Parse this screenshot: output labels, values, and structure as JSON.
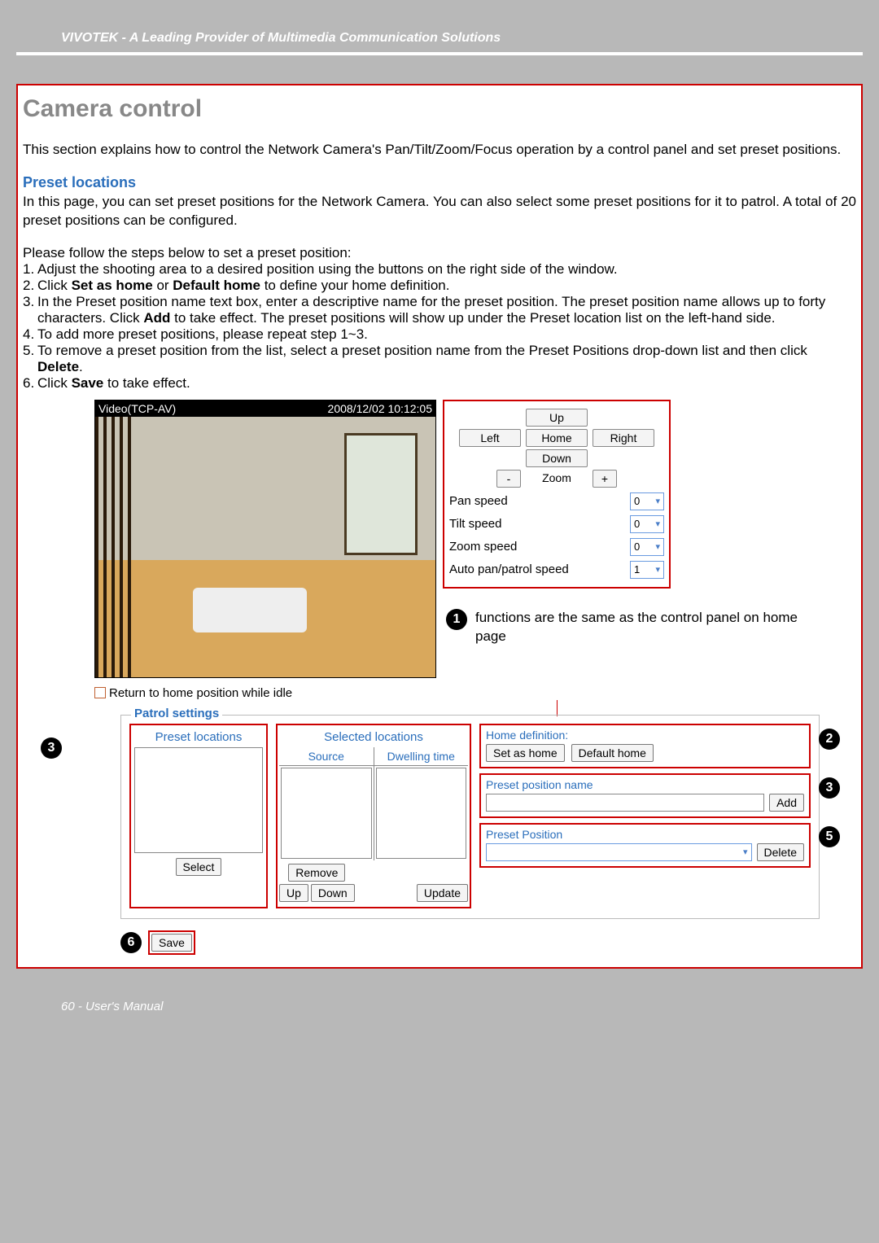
{
  "header": {
    "company_line": "VIVOTEK - A Leading Provider of Multimedia Communication Solutions"
  },
  "section": {
    "title": "Camera control",
    "intro": "This section explains how to control the Network Camera's Pan/Tilt/Zoom/Focus operation by a control panel and set preset positions.",
    "preset_heading": "Preset locations",
    "preset_desc": "In this page, you can set preset positions for the Network Camera. You can also select some preset positions for it to patrol. A total of 20 preset positions can be configured.",
    "steps_intro": "Please follow the steps below to set a preset position:",
    "steps": [
      "Adjust the shooting area to a desired position using the buttons on the right side of the window.",
      "Click Set as home or Default home to define your home definition.",
      "In the Preset position name text box, enter a descriptive name for the preset position. The preset position name allows up to forty characters. Click Add to take effect. The preset positions will show up under the Preset location list on the left-hand side.",
      "To add more preset positions, please repeat step 1~3.",
      "To remove a preset position from the list, select a preset position name from the Preset Positions drop-down list and then click Delete.",
      "Click Save to take effect."
    ],
    "step_bold": {
      "1": [
        "Set as home",
        "Default home"
      ],
      "2": [
        "Add"
      ],
      "4": [
        "Delete"
      ],
      "5": [
        "Save"
      ]
    }
  },
  "video": {
    "codec": "Video(TCP-AV)",
    "timestamp": "2008/12/02 10:12:05",
    "idle_label": "Return to home position while idle"
  },
  "ctrl": {
    "up": "Up",
    "down": "Down",
    "left": "Left",
    "right": "Right",
    "home": "Home",
    "zoom": "Zoom",
    "minus": "-",
    "plus": "+",
    "pan_speed": "Pan speed",
    "tilt_speed": "Tilt speed",
    "zoom_speed": "Zoom speed",
    "auto_speed": "Auto pan/patrol speed",
    "val_pan": "0",
    "val_tilt": "0",
    "val_zoom": "0",
    "val_auto": "1"
  },
  "annot": {
    "a1": "functions are the same as the control panel on  home page"
  },
  "patrol": {
    "legend": "Patrol settings",
    "preset_locations": "Preset locations",
    "selected_locations": "Selected locations",
    "source": "Source",
    "dwelling": "Dwelling time",
    "select": "Select",
    "remove": "Remove",
    "up": "Up",
    "down": "Down",
    "update": "Update"
  },
  "right": {
    "home_def": "Home definition:",
    "set_home": "Set as home",
    "default_home": "Default home",
    "ppn": "Preset position name",
    "add": "Add",
    "pp": "Preset Position",
    "delete": "Delete"
  },
  "save": {
    "label": "Save"
  },
  "badges": {
    "b1": "1",
    "b2": "2",
    "b3": "3",
    "b5": "5",
    "b6": "6"
  },
  "footer": {
    "text": "60 - User's Manual"
  }
}
